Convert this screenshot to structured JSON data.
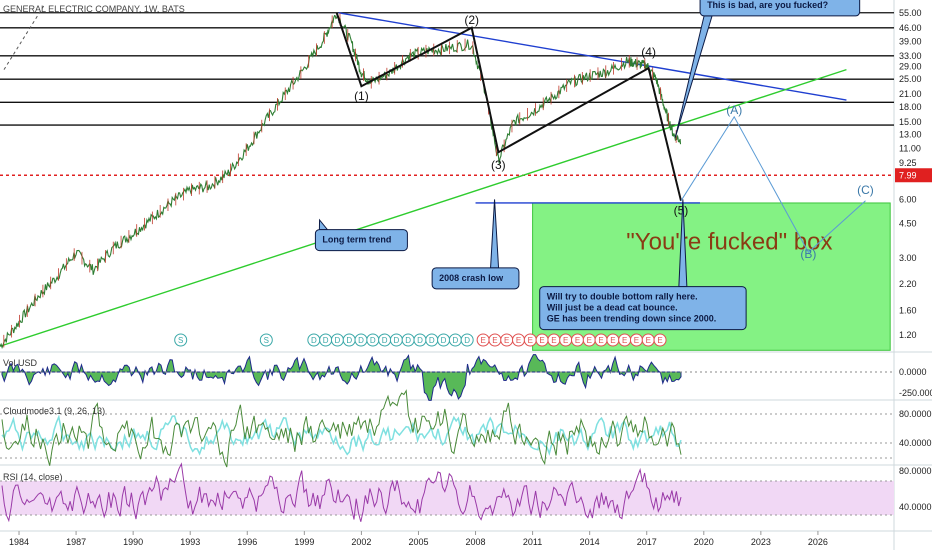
{
  "chart_data": [
    {
      "type": "line",
      "title": "GENERAL ELECTRIC COMPANY, 1W, BATS",
      "x_ticks": [
        "1984",
        "1987",
        "1990",
        "1993",
        "1996",
        "1999",
        "2002",
        "2005",
        "2008",
        "2011",
        "2014",
        "2017",
        "2020",
        "2023",
        "2026"
      ],
      "y_ticks": [
        "55.00",
        "46.00",
        "39.00",
        "33.00",
        "29.00",
        "25.00",
        "21.00",
        "18.00",
        "15.00",
        "13.00",
        "11.00",
        "9.25",
        "7.99",
        "6.00",
        "4.50",
        "3.00",
        "2.20",
        "1.60",
        "1.20"
      ],
      "y_scale": "log",
      "last_price": "7.99",
      "last_price_color": "#e02020",
      "price_color": "#2e7d32",
      "price_series": {
        "x": [
          1983.0,
          1984.0,
          1985.0,
          1986.0,
          1987.0,
          1987.9,
          1989.0,
          1990.0,
          1991.0,
          1992.0,
          1993.0,
          1994.0,
          1995.0,
          1996.0,
          1997.0,
          1998.0,
          1999.0,
          2000.0,
          2000.7,
          2001.5,
          2002.0,
          2002.5,
          2003.5,
          2004.5,
          2005.5,
          2006.5,
          2007.8,
          2008.5,
          2009.2,
          2010.0,
          2011.0,
          2012.0,
          2013.0,
          2014.0,
          2015.0,
          2016.0,
          2016.5,
          2017.0,
          2017.5,
          2018.0,
          2018.4,
          2018.8
        ],
        "y": [
          1.05,
          1.4,
          1.9,
          2.4,
          3.2,
          2.6,
          3.4,
          4.0,
          4.8,
          5.8,
          6.7,
          7.0,
          8.2,
          11.0,
          15.5,
          21.0,
          28.5,
          40.0,
          55.0,
          38.0,
          27.0,
          24.0,
          27.0,
          33.0,
          35.0,
          36.0,
          38.0,
          22.0,
          9.5,
          15.0,
          17.0,
          20.0,
          24.0,
          26.0,
          27.5,
          31.0,
          30.0,
          29.5,
          25.0,
          17.0,
          13.0,
          12.0
        ]
      },
      "horizontal_levels": [
        55.0,
        46.0,
        33.0,
        25.0,
        19.0,
        14.5
      ],
      "downtrend_line": {
        "x": [
          2000.8,
          2027.5
        ],
        "y": [
          55.0,
          19.5
        ],
        "color": "#1f3fd0"
      },
      "uptrend_line": {
        "x": [
          1983.0,
          2027.5
        ],
        "y": [
          1.05,
          28.0
        ],
        "color": "#2ecc2e"
      },
      "wave_path": {
        "x": [
          2000.7,
          2002.0,
          2007.8,
          2009.2,
          2017.1,
          2018.8
        ],
        "y": [
          55.0,
          23.0,
          46.0,
          10.5,
          28.5,
          5.9
        ]
      },
      "projection": {
        "x": [
          2018.8,
          2021.6,
          2025.5,
          2028.5
        ],
        "y": [
          5.9,
          16.0,
          3.2,
          5.9
        ]
      },
      "wave_labels": [
        {
          "text": "(1)",
          "x": 2002.0,
          "y": 19.5
        },
        {
          "text": "(2)",
          "x": 2007.8,
          "y": 48.0
        },
        {
          "text": "(3)",
          "x": 2009.2,
          "y": 8.6
        },
        {
          "text": "(4)",
          "x": 2017.1,
          "y": 33.0
        },
        {
          "text": "(5)",
          "x": 2018.8,
          "y": 5.0
        },
        {
          "text": "(A)",
          "x": 2021.6,
          "y": 16.5,
          "blue": true
        },
        {
          "text": "(B)",
          "x": 2025.5,
          "y": 3.0,
          "blue": true
        },
        {
          "text": "(C)",
          "x": 2028.5,
          "y": 6.4,
          "blue": true
        }
      ],
      "box": {
        "x0": 2011.0,
        "x1": 2029.8,
        "y0": 5.75,
        "y1": 1.0,
        "label": "\"You're fucked\" box"
      },
      "box_top_line": {
        "x": [
          2008.0,
          2019.8
        ],
        "y": [
          5.75,
          5.75
        ]
      },
      "callouts": [
        {
          "text": [
            "Long term trend"
          ],
          "x": 2002.0,
          "y": 3.7,
          "tip_x": 1999.8,
          "tip_y": 4.7
        },
        {
          "text": [
            "2008 crash low"
          ],
          "x": 2008.0,
          "y": 2.35,
          "tip_x": 2009.0,
          "tip_y": 6.0
        },
        {
          "text": [
            "This is bad, are you fucked?"
          ],
          "x": 2024.0,
          "y": 60.0,
          "tip_x": 2018.5,
          "tip_y": 12.5
        },
        {
          "text": [
            "Will try to double bottom rally here.",
            "Will just be a dead cat bounce.",
            "GE has been trending down since 2000."
          ],
          "x": 2016.8,
          "y": 1.65,
          "tip_x": 2018.9,
          "tip_y": 6.0
        }
      ],
      "event_markers": [
        {
          "text": "S",
          "x": 1992.5,
          "color": "#3aa8a8"
        },
        {
          "text": "S",
          "x": 1997.0,
          "color": "#3aa8a8"
        },
        {
          "text": "D",
          "x": 1999.5,
          "count": 14,
          "spacing": 0.62,
          "color": "#3aa8a8"
        },
        {
          "text": "E",
          "x": 2008.4,
          "count": 16,
          "spacing": 0.62,
          "color": "#e05050"
        }
      ]
    },
    {
      "type": "area",
      "title": "Vol USD",
      "y_ticks": [
        "0.0000",
        "-250.0000"
      ],
      "colors": {
        "positive": "#2ea82e",
        "negative": "#d83030",
        "line": "#1e2a8a"
      }
    },
    {
      "type": "line",
      "title": "Cloudmode3.1 (9, 26, 13)",
      "y_ticks": [
        "80.0000",
        "40.0000"
      ],
      "colors": {
        "line": "#4a8a3a",
        "aux": "#7fe0e0",
        "bars": "#d06060"
      }
    },
    {
      "type": "line",
      "title": "RSI (14, close)",
      "y_ticks": [
        "80.0000",
        "40.0000"
      ],
      "colors": {
        "line": "#9a3aa8",
        "band": "#f1d8f5"
      }
    }
  ]
}
